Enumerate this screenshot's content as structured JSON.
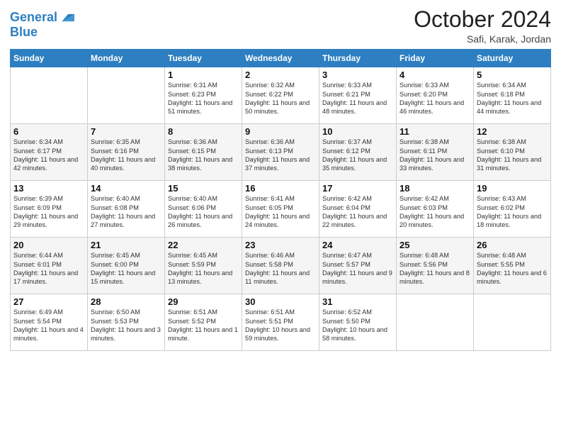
{
  "logo": {
    "line1": "General",
    "line2": "Blue"
  },
  "title": "October 2024",
  "location": "Safi, Karak, Jordan",
  "weekdays": [
    "Sunday",
    "Monday",
    "Tuesday",
    "Wednesday",
    "Thursday",
    "Friday",
    "Saturday"
  ],
  "weeks": [
    [
      {
        "day": "",
        "sunrise": "",
        "sunset": "",
        "daylight": ""
      },
      {
        "day": "",
        "sunrise": "",
        "sunset": "",
        "daylight": ""
      },
      {
        "day": "1",
        "sunrise": "Sunrise: 6:31 AM",
        "sunset": "Sunset: 6:23 PM",
        "daylight": "Daylight: 11 hours and 51 minutes."
      },
      {
        "day": "2",
        "sunrise": "Sunrise: 6:32 AM",
        "sunset": "Sunset: 6:22 PM",
        "daylight": "Daylight: 11 hours and 50 minutes."
      },
      {
        "day": "3",
        "sunrise": "Sunrise: 6:33 AM",
        "sunset": "Sunset: 6:21 PM",
        "daylight": "Daylight: 11 hours and 48 minutes."
      },
      {
        "day": "4",
        "sunrise": "Sunrise: 6:33 AM",
        "sunset": "Sunset: 6:20 PM",
        "daylight": "Daylight: 11 hours and 46 minutes."
      },
      {
        "day": "5",
        "sunrise": "Sunrise: 6:34 AM",
        "sunset": "Sunset: 6:18 PM",
        "daylight": "Daylight: 11 hours and 44 minutes."
      }
    ],
    [
      {
        "day": "6",
        "sunrise": "Sunrise: 6:34 AM",
        "sunset": "Sunset: 6:17 PM",
        "daylight": "Daylight: 11 hours and 42 minutes."
      },
      {
        "day": "7",
        "sunrise": "Sunrise: 6:35 AM",
        "sunset": "Sunset: 6:16 PM",
        "daylight": "Daylight: 11 hours and 40 minutes."
      },
      {
        "day": "8",
        "sunrise": "Sunrise: 6:36 AM",
        "sunset": "Sunset: 6:15 PM",
        "daylight": "Daylight: 11 hours and 38 minutes."
      },
      {
        "day": "9",
        "sunrise": "Sunrise: 6:36 AM",
        "sunset": "Sunset: 6:13 PM",
        "daylight": "Daylight: 11 hours and 37 minutes."
      },
      {
        "day": "10",
        "sunrise": "Sunrise: 6:37 AM",
        "sunset": "Sunset: 6:12 PM",
        "daylight": "Daylight: 11 hours and 35 minutes."
      },
      {
        "day": "11",
        "sunrise": "Sunrise: 6:38 AM",
        "sunset": "Sunset: 6:11 PM",
        "daylight": "Daylight: 11 hours and 33 minutes."
      },
      {
        "day": "12",
        "sunrise": "Sunrise: 6:38 AM",
        "sunset": "Sunset: 6:10 PM",
        "daylight": "Daylight: 11 hours and 31 minutes."
      }
    ],
    [
      {
        "day": "13",
        "sunrise": "Sunrise: 6:39 AM",
        "sunset": "Sunset: 6:09 PM",
        "daylight": "Daylight: 11 hours and 29 minutes."
      },
      {
        "day": "14",
        "sunrise": "Sunrise: 6:40 AM",
        "sunset": "Sunset: 6:08 PM",
        "daylight": "Daylight: 11 hours and 27 minutes."
      },
      {
        "day": "15",
        "sunrise": "Sunrise: 6:40 AM",
        "sunset": "Sunset: 6:06 PM",
        "daylight": "Daylight: 11 hours and 26 minutes."
      },
      {
        "day": "16",
        "sunrise": "Sunrise: 6:41 AM",
        "sunset": "Sunset: 6:05 PM",
        "daylight": "Daylight: 11 hours and 24 minutes."
      },
      {
        "day": "17",
        "sunrise": "Sunrise: 6:42 AM",
        "sunset": "Sunset: 6:04 PM",
        "daylight": "Daylight: 11 hours and 22 minutes."
      },
      {
        "day": "18",
        "sunrise": "Sunrise: 6:42 AM",
        "sunset": "Sunset: 6:03 PM",
        "daylight": "Daylight: 11 hours and 20 minutes."
      },
      {
        "day": "19",
        "sunrise": "Sunrise: 6:43 AM",
        "sunset": "Sunset: 6:02 PM",
        "daylight": "Daylight: 11 hours and 18 minutes."
      }
    ],
    [
      {
        "day": "20",
        "sunrise": "Sunrise: 6:44 AM",
        "sunset": "Sunset: 6:01 PM",
        "daylight": "Daylight: 11 hours and 17 minutes."
      },
      {
        "day": "21",
        "sunrise": "Sunrise: 6:45 AM",
        "sunset": "Sunset: 6:00 PM",
        "daylight": "Daylight: 11 hours and 15 minutes."
      },
      {
        "day": "22",
        "sunrise": "Sunrise: 6:45 AM",
        "sunset": "Sunset: 5:59 PM",
        "daylight": "Daylight: 11 hours and 13 minutes."
      },
      {
        "day": "23",
        "sunrise": "Sunrise: 6:46 AM",
        "sunset": "Sunset: 5:58 PM",
        "daylight": "Daylight: 11 hours and 11 minutes."
      },
      {
        "day": "24",
        "sunrise": "Sunrise: 6:47 AM",
        "sunset": "Sunset: 5:57 PM",
        "daylight": "Daylight: 11 hours and 9 minutes."
      },
      {
        "day": "25",
        "sunrise": "Sunrise: 6:48 AM",
        "sunset": "Sunset: 5:56 PM",
        "daylight": "Daylight: 11 hours and 8 minutes."
      },
      {
        "day": "26",
        "sunrise": "Sunrise: 6:48 AM",
        "sunset": "Sunset: 5:55 PM",
        "daylight": "Daylight: 11 hours and 6 minutes."
      }
    ],
    [
      {
        "day": "27",
        "sunrise": "Sunrise: 6:49 AM",
        "sunset": "Sunset: 5:54 PM",
        "daylight": "Daylight: 11 hours and 4 minutes."
      },
      {
        "day": "28",
        "sunrise": "Sunrise: 6:50 AM",
        "sunset": "Sunset: 5:53 PM",
        "daylight": "Daylight: 11 hours and 3 minutes."
      },
      {
        "day": "29",
        "sunrise": "Sunrise: 6:51 AM",
        "sunset": "Sunset: 5:52 PM",
        "daylight": "Daylight: 11 hours and 1 minute."
      },
      {
        "day": "30",
        "sunrise": "Sunrise: 6:51 AM",
        "sunset": "Sunset: 5:51 PM",
        "daylight": "Daylight: 10 hours and 59 minutes."
      },
      {
        "day": "31",
        "sunrise": "Sunrise: 6:52 AM",
        "sunset": "Sunset: 5:50 PM",
        "daylight": "Daylight: 10 hours and 58 minutes."
      },
      {
        "day": "",
        "sunrise": "",
        "sunset": "",
        "daylight": ""
      },
      {
        "day": "",
        "sunrise": "",
        "sunset": "",
        "daylight": ""
      }
    ]
  ]
}
